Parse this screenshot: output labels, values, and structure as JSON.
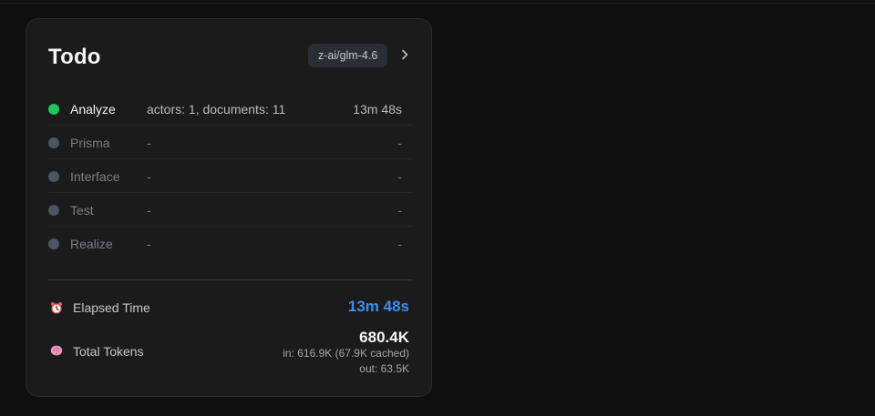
{
  "panel": {
    "title": "Todo",
    "model": "z-ai/glm-4.6"
  },
  "steps": [
    {
      "name": "Analyze",
      "detail": "actors: 1, documents: 11",
      "time": "13m 48s",
      "status": "active"
    },
    {
      "name": "Prisma",
      "detail": "-",
      "time": "-",
      "status": "pending"
    },
    {
      "name": "Interface",
      "detail": "-",
      "time": "-",
      "status": "pending"
    },
    {
      "name": "Test",
      "detail": "-",
      "time": "-",
      "status": "pending"
    },
    {
      "name": "Realize",
      "detail": "-",
      "time": "-",
      "status": "pending"
    }
  ],
  "stats": {
    "elapsed_label": "Elapsed Time",
    "elapsed_value": "13m 48s",
    "elapsed_icon": "alarm-clock-icon",
    "tokens_label": "Total Tokens",
    "tokens_total": "680.4K",
    "tokens_in": "in: 616.9K (67.9K cached)",
    "tokens_out": "out: 63.5K",
    "tokens_icon": "brain-icon"
  },
  "colors": {
    "active_dot": "#22c55e",
    "pending_dot": "#4b5563",
    "elapsed_accent": "#3b8ff0"
  }
}
